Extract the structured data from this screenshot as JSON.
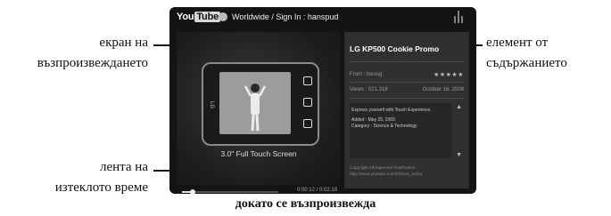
{
  "annotations": {
    "player_label_line1": "екран на",
    "player_label_line2": "възпроизвеждането",
    "content_label_line1": "елемент от",
    "content_label_line2": "съдържанието",
    "timebar_label_line1": "лента на",
    "timebar_label_line2": "изтеклото време",
    "caption": "докато се възпроизвежда"
  },
  "topbar": {
    "logo_you": "You",
    "logo_tube": "Tube",
    "region": "Worldwide / Sign In : hanspud",
    "icons": [
      "globe-icon",
      "antenna-icon"
    ]
  },
  "player": {
    "promo_text": "3.0\" Full Touch Screen",
    "phone_side_text": "LG",
    "progress_fraction": 0.11,
    "time": "0:00:12 / 0:02:19"
  },
  "panel": {
    "title": "LG KP500 Cookie Promo",
    "from": "From : lovusg",
    "stars": "★★★★★",
    "views": "Views : 021,318",
    "date": "October 16, 2008",
    "description": "Express yourself with Touch Experience.",
    "added": "Added : May 25, 2009",
    "category": "Category : Science & Technology",
    "copyright_line1": "Copyright Infringement Notification",
    "copyright_line2": "http://www.youtube.com/t/dmca_policy"
  }
}
